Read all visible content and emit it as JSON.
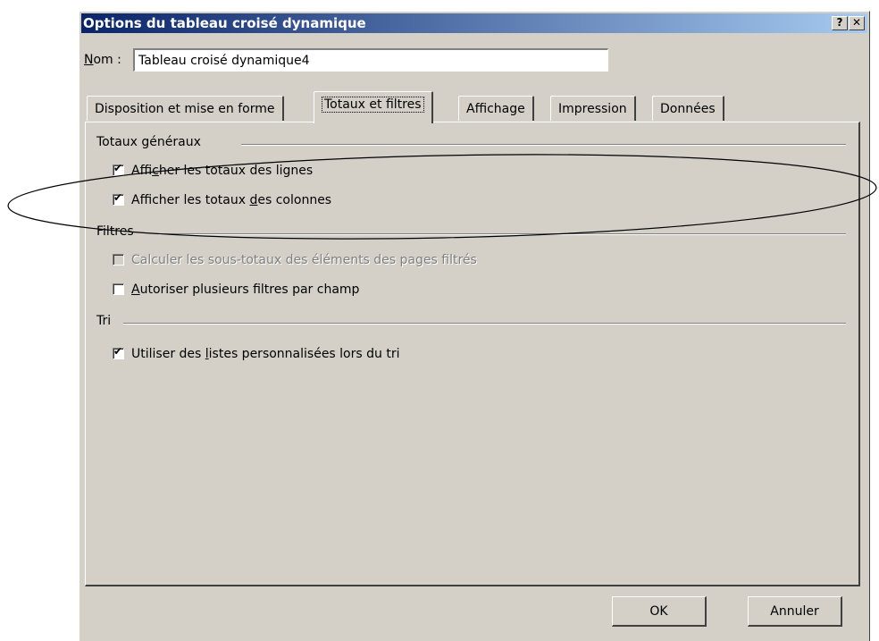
{
  "dialog": {
    "title": "Options du tableau croisé dynamique",
    "help_label": "?",
    "close_label": "✕"
  },
  "name_field": {
    "label_prefix": "N",
    "label_rest": "om :",
    "value": "Tableau croisé dynamique4"
  },
  "tabs": [
    {
      "label": "Disposition et mise en forme",
      "active": false
    },
    {
      "label": "Totaux et filtres",
      "active": true
    },
    {
      "label": "Affichage",
      "active": false
    },
    {
      "label": "Impression",
      "active": false
    },
    {
      "label": "Données",
      "active": false
    }
  ],
  "groups": {
    "grand_totals": {
      "title": "Totaux généraux",
      "items": [
        {
          "pre": "Affi",
          "accel": "c",
          "post": "her les totaux des lignes",
          "checked": true,
          "enabled": true
        },
        {
          "pre": "Afficher les totaux ",
          "accel": "d",
          "post": "es colonnes",
          "checked": true,
          "enabled": true
        }
      ]
    },
    "filters": {
      "title": "Filtres",
      "items": [
        {
          "pre": "Calculer les sous-totaux des éléments des pages filtrés",
          "accel": "",
          "post": "",
          "checked": false,
          "enabled": false
        },
        {
          "pre": "",
          "accel": "A",
          "post": "utoriser plusieurs filtres par champ",
          "checked": false,
          "enabled": true
        }
      ]
    },
    "sort": {
      "title": "Tri",
      "items": [
        {
          "pre": "Utiliser des ",
          "accel": "l",
          "post": "istes personnalisées lors du tri",
          "checked": true,
          "enabled": true
        }
      ]
    }
  },
  "buttons": {
    "ok": "OK",
    "cancel": "Annuler"
  },
  "colors": {
    "title_start": "#0a246a",
    "title_end": "#a6caf0",
    "face": "#d4d0c8",
    "disabled_text": "#808080"
  },
  "icons": {
    "check": "✔"
  }
}
